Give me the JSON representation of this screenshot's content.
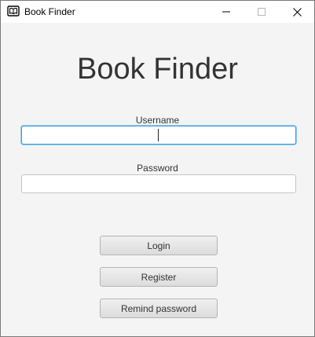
{
  "window": {
    "title": "Book Finder",
    "icon": "book-icon",
    "controls": {
      "minimize_icon": "minimize-icon",
      "maximize_icon": "maximize-icon",
      "close_icon": "close-icon"
    }
  },
  "form": {
    "heading": "Book Finder",
    "username": {
      "label": "Username",
      "value": ""
    },
    "password": {
      "label": "Password",
      "value": ""
    }
  },
  "buttons": {
    "login": "Login",
    "register": "Register",
    "remind": "Remind password"
  },
  "colors": {
    "focus_border": "#3c9bdc",
    "background": "#f4f4f4",
    "text": "#333333"
  }
}
